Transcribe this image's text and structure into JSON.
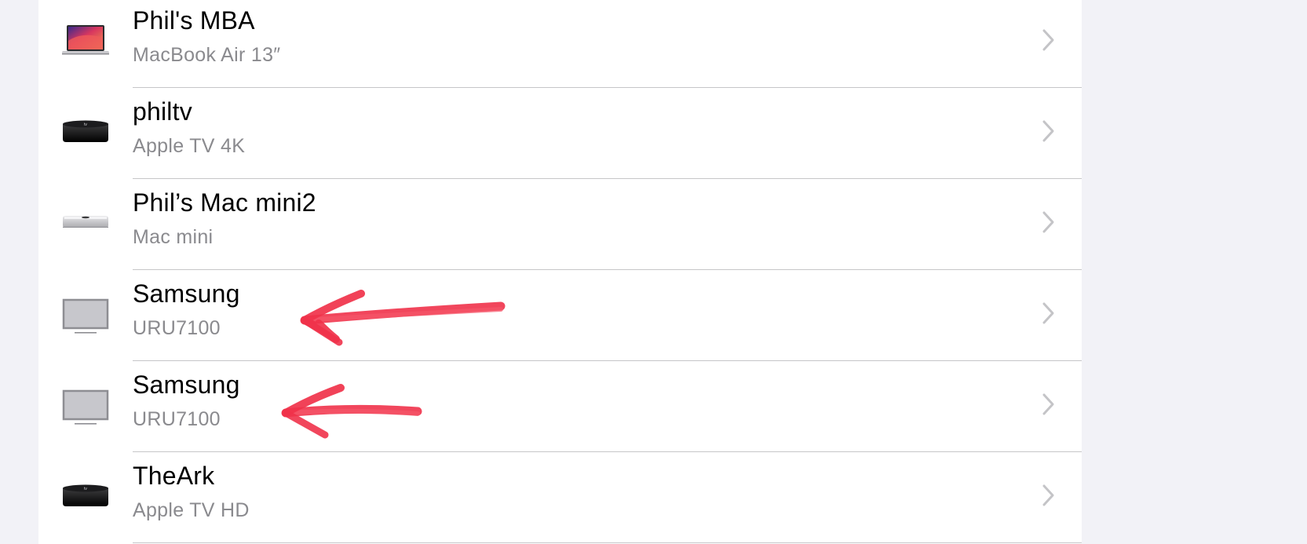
{
  "devices": [
    {
      "name": "Phil's MBA",
      "model": "MacBook Air 13″",
      "icon": "macbook-air-icon"
    },
    {
      "name": "philtv",
      "model": "Apple TV 4K",
      "icon": "apple-tv-icon"
    },
    {
      "name": "Phil’s Mac mini2",
      "model": "Mac mini",
      "icon": "mac-mini-icon"
    },
    {
      "name": "Samsung",
      "model": "URU7100",
      "icon": "generic-display-icon"
    },
    {
      "name": "Samsung",
      "model": "URU7100",
      "icon": "generic-display-icon"
    },
    {
      "name": "TheArk",
      "model": "Apple TV HD",
      "icon": "apple-tv-icon"
    }
  ],
  "colors": {
    "background": "#f2f2f7",
    "panel": "#ffffff",
    "secondary_text": "#8a8a8e",
    "chevron": "#c4c4c7",
    "divider": "#c6c6c8",
    "annotation_arrow": "#f0324a"
  },
  "chevron_icon": "chevron-right-icon",
  "annotations": [
    {
      "type": "arrow",
      "points_to_row": 3
    },
    {
      "type": "arrow",
      "points_to_row": 4
    }
  ]
}
